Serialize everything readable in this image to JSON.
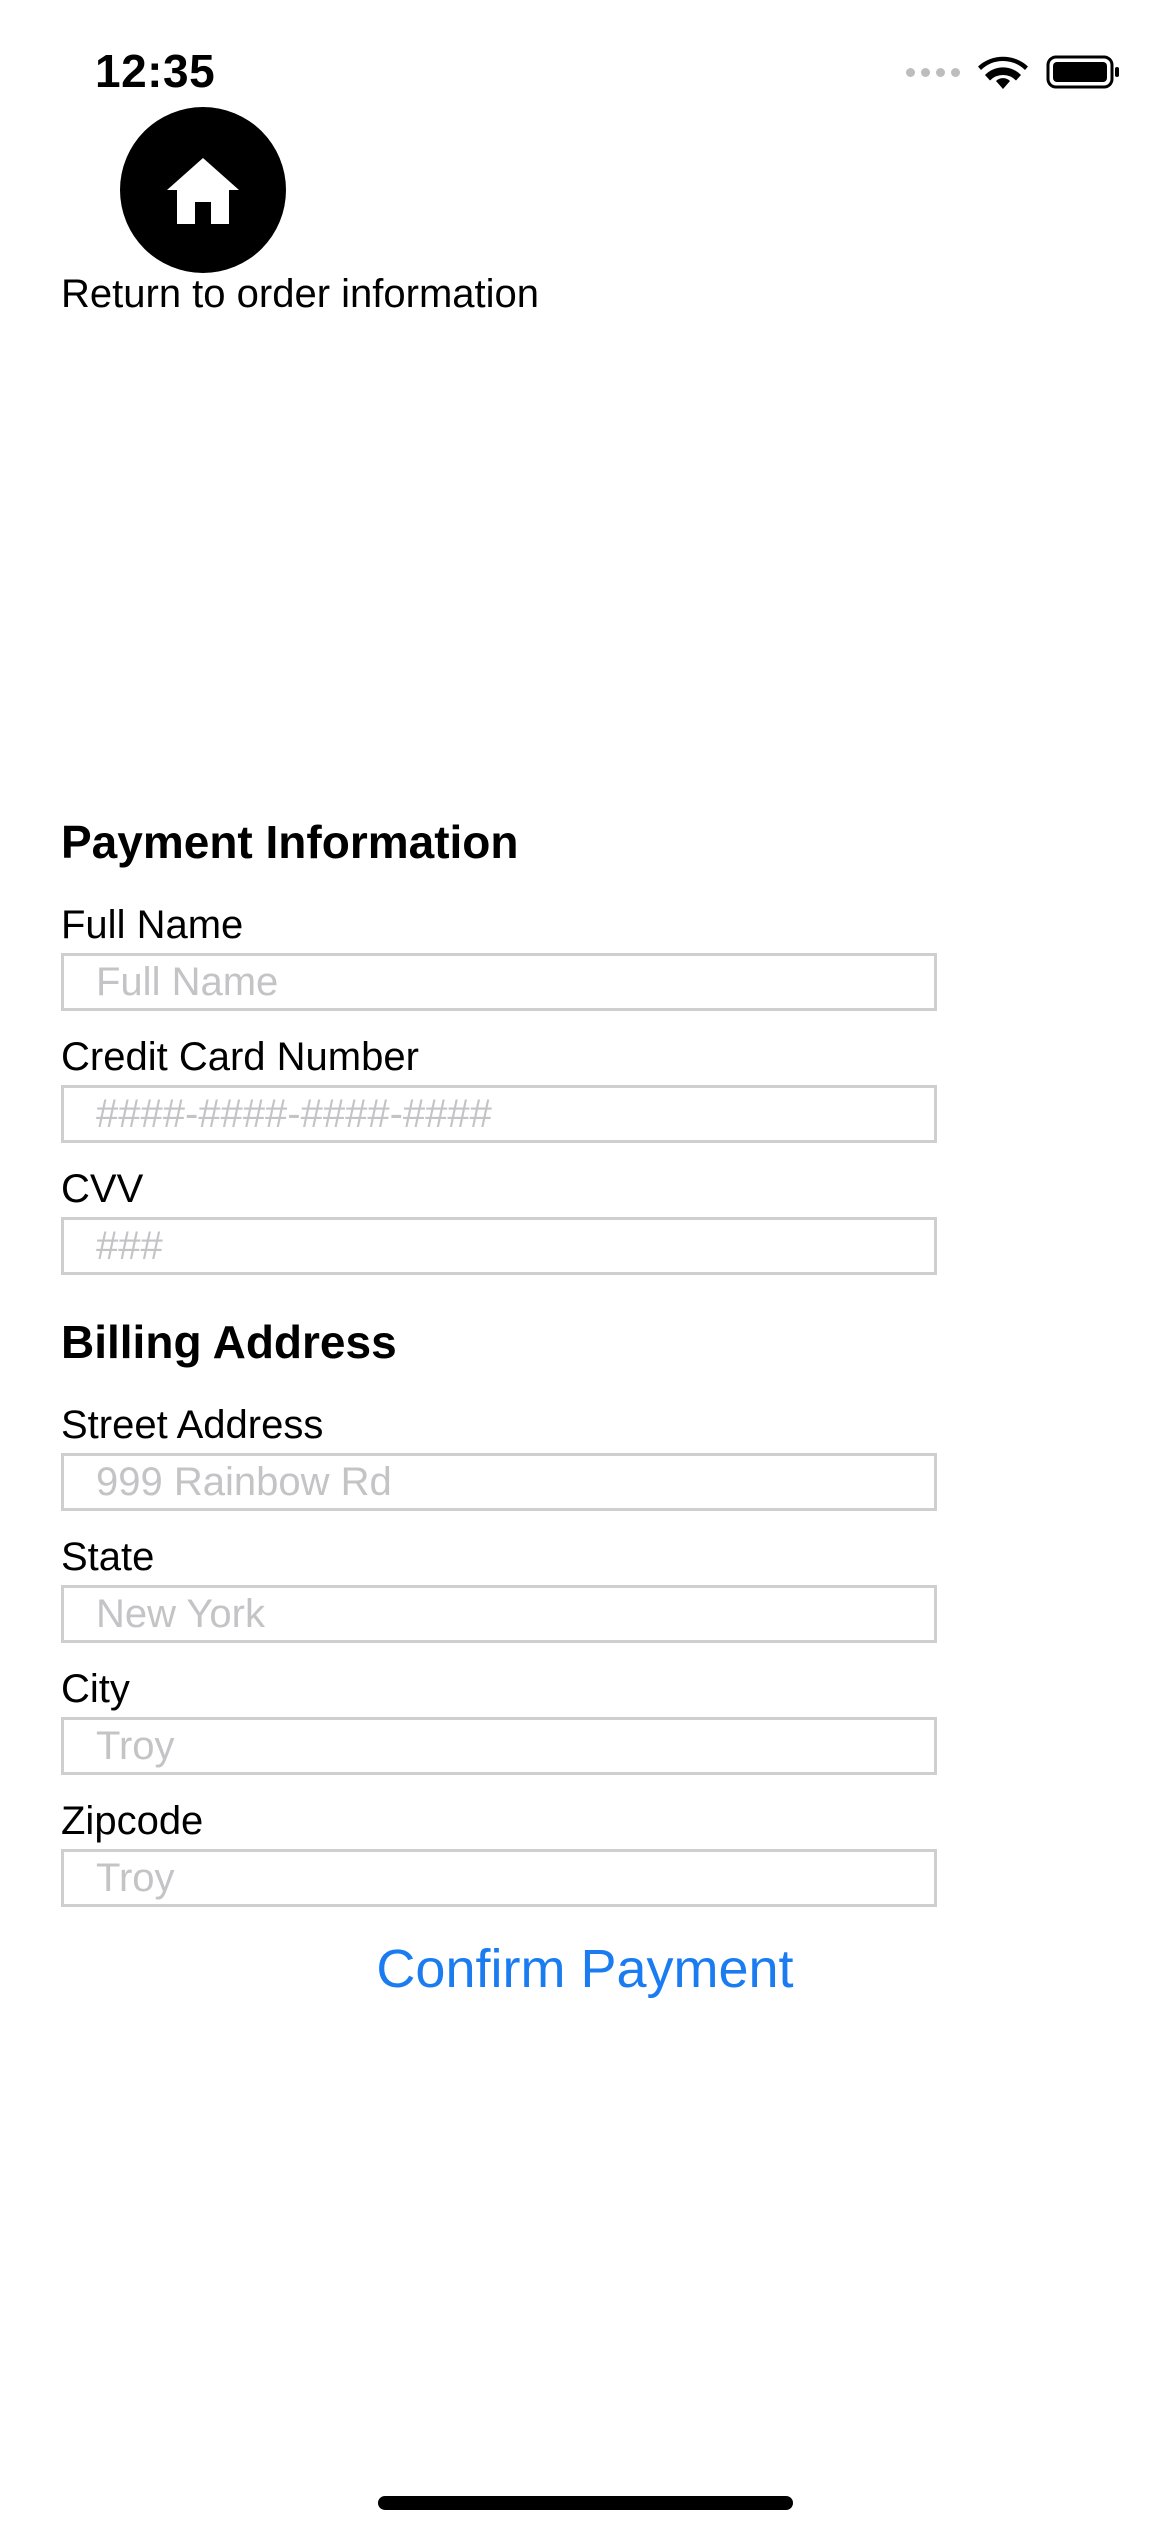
{
  "status_bar": {
    "time": "12:35",
    "icons": [
      "signal-dots-icon",
      "wifi-icon",
      "battery-icon"
    ]
  },
  "nav": {
    "home_icon": "home-icon",
    "return_label": "Return to order information"
  },
  "payment": {
    "title": "Payment Information",
    "full_name": {
      "label": "Full Name",
      "placeholder": "Full Name",
      "value": ""
    },
    "card_number": {
      "label": "Credit Card Number",
      "placeholder": "####-####-####-####",
      "value": ""
    },
    "cvv": {
      "label": "CVV",
      "placeholder": "###",
      "value": ""
    }
  },
  "billing": {
    "title": "Billing Address",
    "street": {
      "label": "Street Address",
      "placeholder": "999 Rainbow Rd",
      "value": ""
    },
    "state": {
      "label": "State",
      "placeholder": "New York",
      "value": ""
    },
    "city": {
      "label": "City",
      "placeholder": "Troy",
      "value": ""
    },
    "zipcode": {
      "label": "Zipcode",
      "placeholder": "Troy",
      "value": ""
    }
  },
  "actions": {
    "confirm_label": "Confirm Payment"
  },
  "colors": {
    "accent": "#1a7cf0",
    "placeholder": "#c4c4c7",
    "input_border": "#cfcfcf"
  }
}
